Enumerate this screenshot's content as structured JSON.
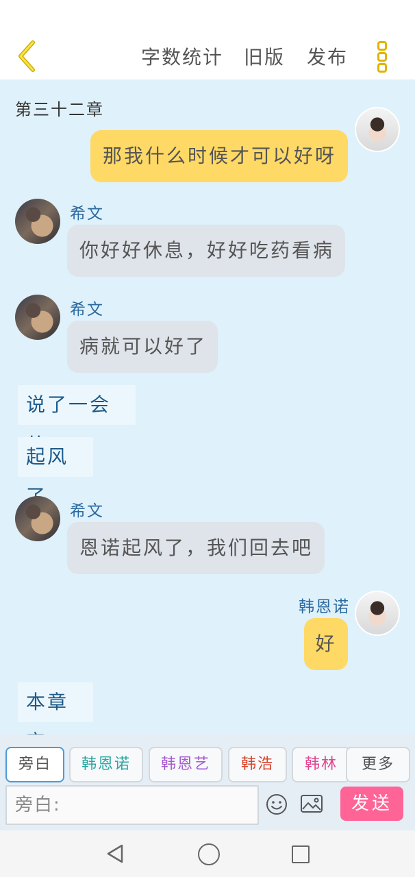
{
  "header": {
    "word_count_label": "字数统计",
    "old_version_label": "旧版",
    "publish_label": "发布"
  },
  "chat": {
    "chapter_title": "第三十二章",
    "messages": [
      {
        "type": "bubble",
        "side": "right",
        "speaker": "",
        "text": "那我什么时候才可以好呀"
      },
      {
        "type": "bubble",
        "side": "left",
        "speaker": "希文",
        "text": "你好好休息，好好吃药看病"
      },
      {
        "type": "bubble",
        "side": "left",
        "speaker": "希文",
        "text": "病就可以好了"
      },
      {
        "type": "narration",
        "text": "说了一会儿"
      },
      {
        "type": "narration",
        "text": "起风了"
      },
      {
        "type": "bubble",
        "side": "left",
        "speaker": "希文",
        "text": "恩诺起风了，我们回去吧"
      },
      {
        "type": "bubble",
        "side": "right",
        "speaker": "韩恩诺",
        "text": "好"
      },
      {
        "type": "narration",
        "text": "本章完"
      }
    ]
  },
  "composer": {
    "roles": [
      {
        "label": "旁白",
        "color": "#555555"
      },
      {
        "label": "韩恩诺",
        "color": "#2aa6a0"
      },
      {
        "label": "韩恩艺",
        "color": "#a55ad1"
      },
      {
        "label": "韩浩",
        "color": "#d8432c"
      },
      {
        "label": "韩林",
        "color": "#e0458f"
      },
      {
        "label": "更多",
        "color": "#555555"
      }
    ],
    "input_placeholder": "旁白:",
    "send_label": "发送",
    "accent_color": "#ff6497"
  }
}
